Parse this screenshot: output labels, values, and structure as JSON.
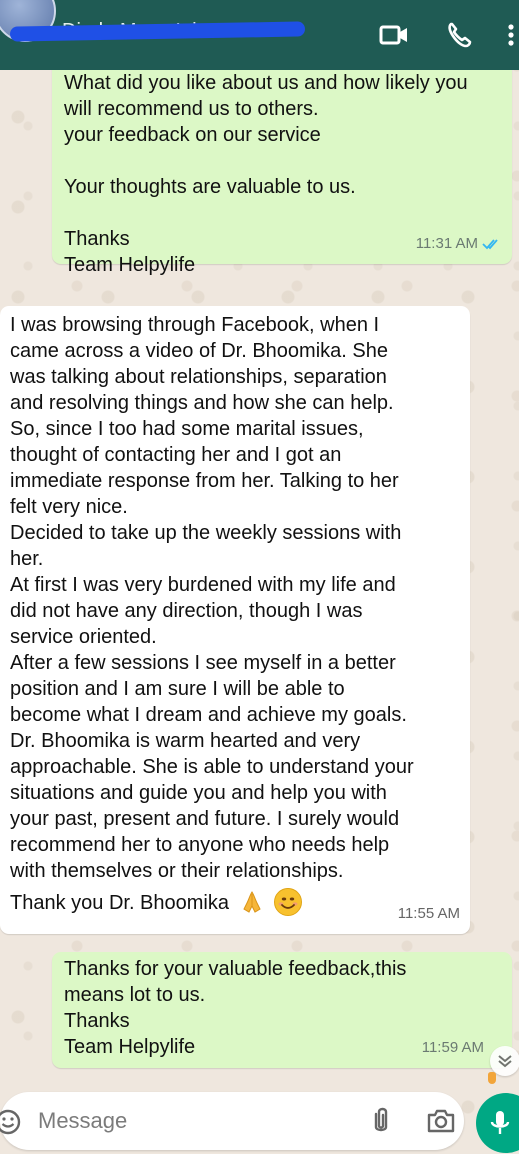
{
  "header": {
    "contact_name": "Dinda Manu Iohn",
    "icons": [
      "video-call-icon",
      "voice-call-icon",
      "more-options-icon"
    ]
  },
  "messages": [
    {
      "direction": "outgoing",
      "lines": [
        "What did you like about us and how likely you",
        "will recommend us to others.",
        "your feedback on our service",
        "",
        "Your thoughts are valuable to us.",
        "",
        "Thanks",
        "Team Helpylife"
      ],
      "time": "11:31 AM",
      "status": "read"
    },
    {
      "direction": "incoming",
      "lines": [
        "I was browsing through Facebook, when I",
        "came across a video of Dr. Bhoomika. She",
        "was talking about relationships, separation",
        "and resolving things and how she can help.",
        "So, since I too had some marital issues,",
        "thought of contacting her and I got an",
        "immediate response from her. Talking to her",
        "felt very nice.",
        "Decided to take up the weekly sessions with",
        "her.",
        "At first I was very burdened with my life and",
        "did not have any direction, though I was",
        "service oriented.",
        "After a few sessions I see myself in a better",
        "position and I am sure I will be able to",
        "become what I dream and achieve my goals.",
        "Dr. Bhoomika is warm hearted and very",
        "approachable. She is able to understand your",
        "situations and guide you and help you with",
        "your past, present and future. I surely would",
        "recommend her to anyone who needs help",
        "with themselves or their relationships."
      ],
      "last_line": "Thank you Dr. Bhoomika",
      "emojis": [
        "folded-hands",
        "smiling-face"
      ],
      "time": "11:55 AM"
    },
    {
      "direction": "outgoing",
      "lines": [
        "Thanks for your valuable feedback,this",
        "means lot to us.",
        "Thanks",
        "Team Helpylife"
      ],
      "time": "11:59 AM"
    }
  ],
  "composer": {
    "placeholder": "Message"
  },
  "colors": {
    "header": "#1f5b54",
    "outgoing_bubble": "#dcf8c6",
    "incoming_bubble": "#ffffff",
    "read_ticks": "#34b7f1",
    "mic_button": "#00a884"
  }
}
